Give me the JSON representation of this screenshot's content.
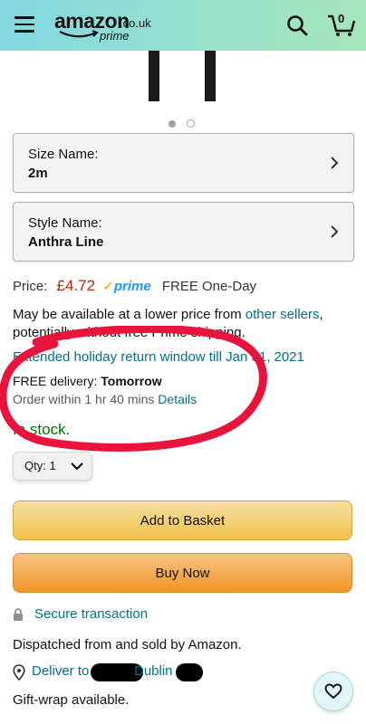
{
  "header": {
    "logo_main": "amazon",
    "logo_tld": ".co.uk",
    "logo_prime": "prime",
    "cart_count": "0"
  },
  "carousel": {
    "dot_count": 2,
    "active_index": 0
  },
  "size_selector": {
    "label": "Size Name:",
    "value": "2m"
  },
  "style_selector": {
    "label": "Style Name:",
    "value": "Anthra Line"
  },
  "price": {
    "label": "Price:",
    "value": "£4.72",
    "prime_check": "✓",
    "prime_text": "prime",
    "shipping": "FREE One-Day"
  },
  "offers": {
    "text_before": "May be available at a lower price from ",
    "link": "other sellers",
    "text_after": ", potentially without free Prime shipping."
  },
  "returns": {
    "text": "Extended holiday return window till Jan 31, 2021"
  },
  "delivery": {
    "label": "FREE delivery: ",
    "day": "Tomorrow",
    "order_within": "Order within 1 hr 40 mins ",
    "details_link": "Details"
  },
  "stock": {
    "text": "In stock."
  },
  "quantity": {
    "label": "Qty:",
    "value": "1"
  },
  "buttons": {
    "add_to_basket": "Add to Basket",
    "buy_now": "Buy Now"
  },
  "secure": {
    "text": "Secure transaction"
  },
  "dispatched": {
    "text": "Dispatched from and sold by Amazon."
  },
  "deliver": {
    "prefix": "Deliver to",
    "city": "Dublin"
  },
  "giftwrap": {
    "text": "Gift-wrap available."
  },
  "colors": {
    "header_start": "#84d8e3",
    "header_end": "#a5e6ba",
    "price": "#b12704",
    "link": "#007185",
    "in_stock": "#007600",
    "prime_blue": "#1a98ff",
    "annotation_red": "#e8143c"
  }
}
